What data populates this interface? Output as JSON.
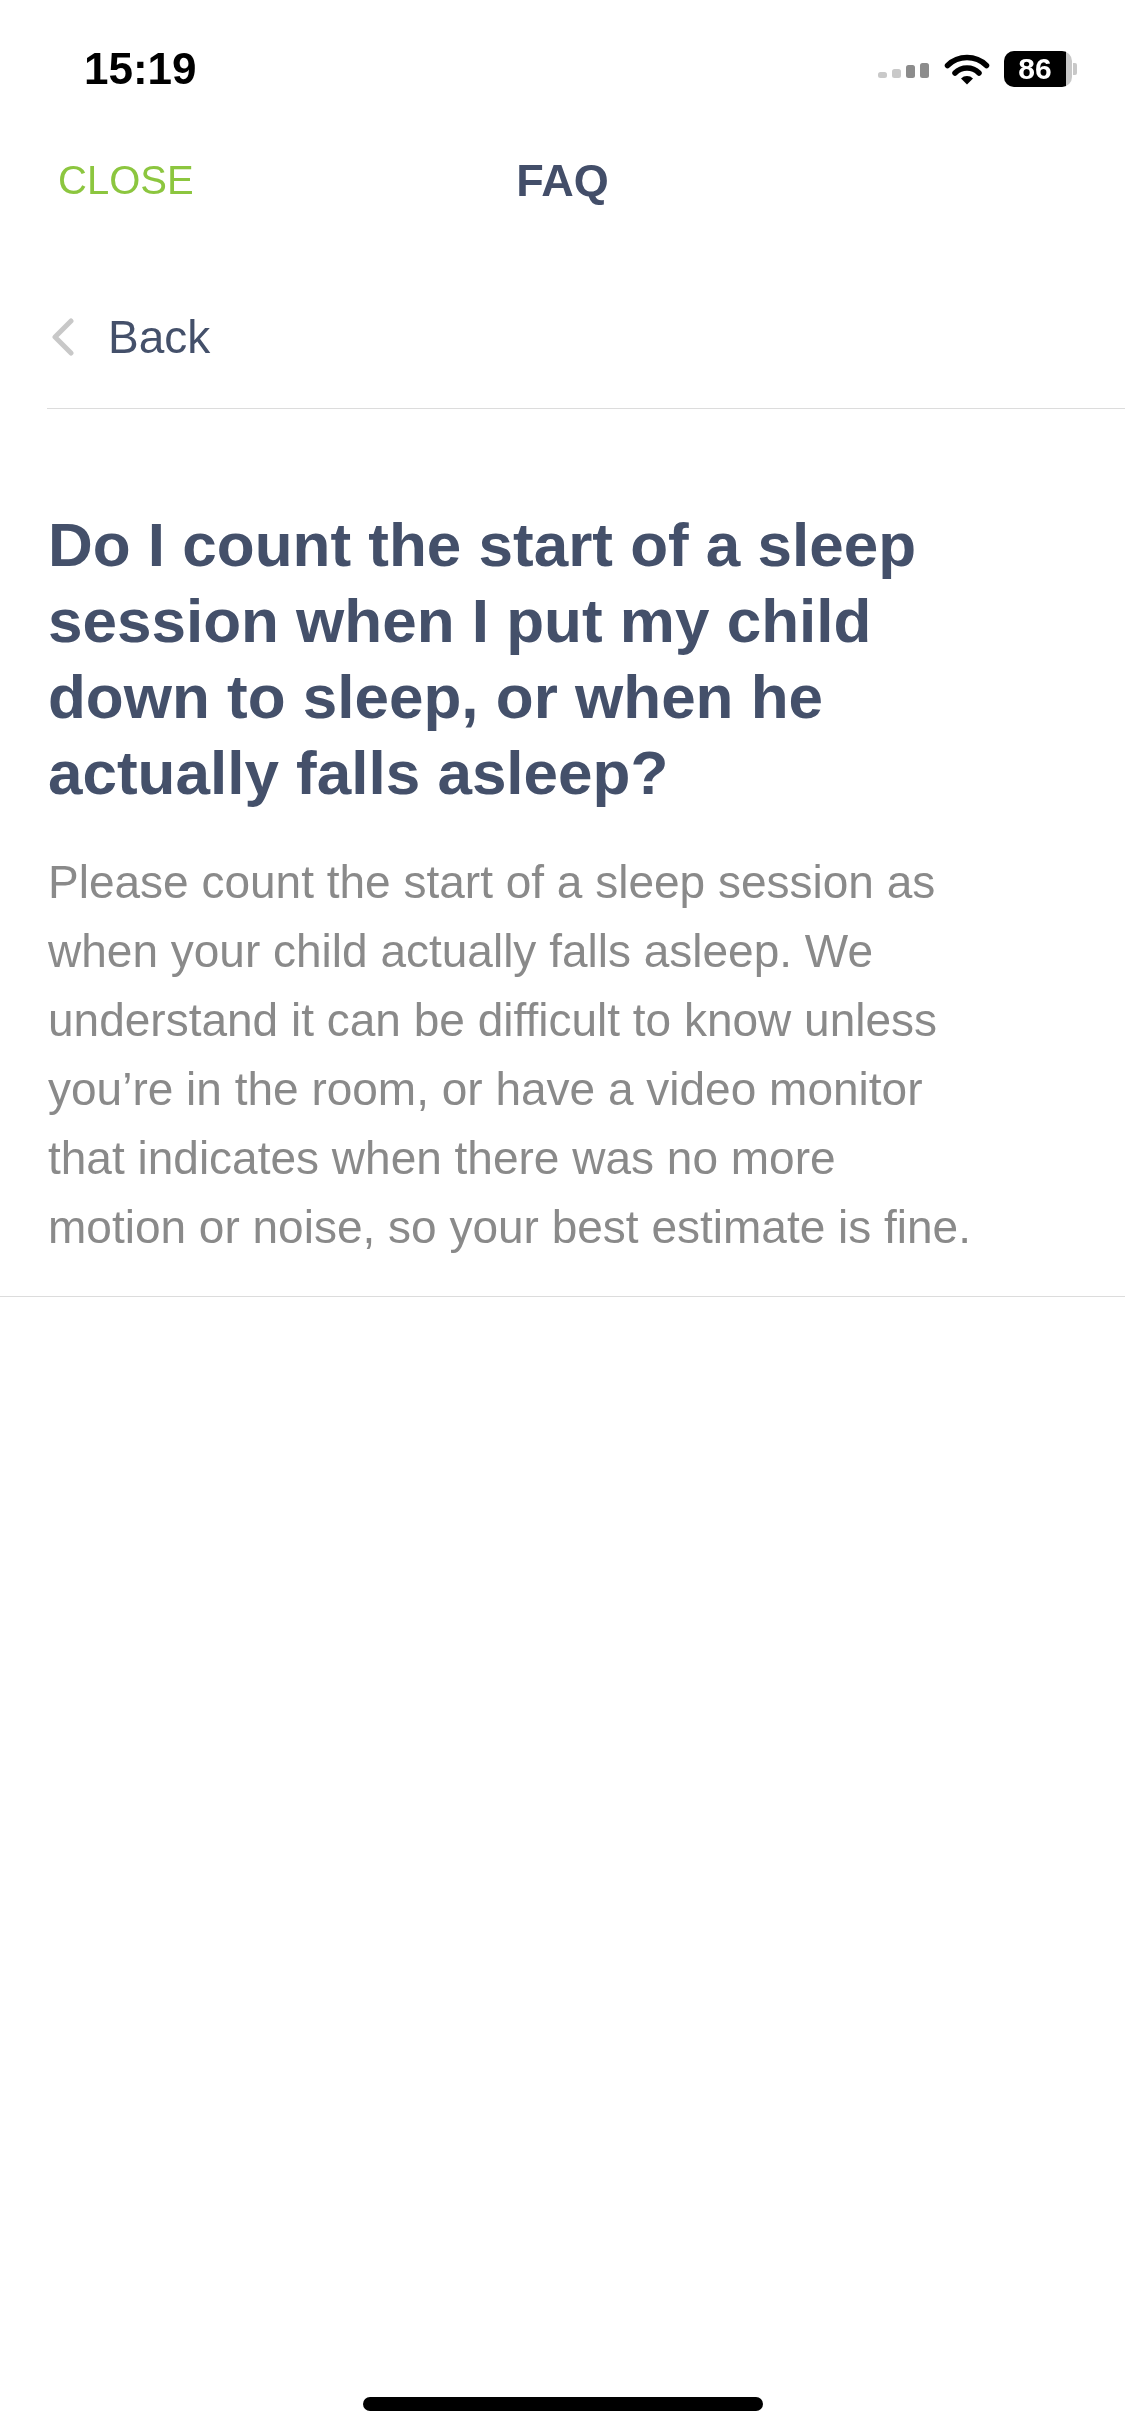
{
  "status_bar": {
    "time": "15:19",
    "battery": "86"
  },
  "nav": {
    "close": "CLOSE",
    "title": "FAQ"
  },
  "back": {
    "label": "Back"
  },
  "faq": {
    "question": "Do I count the start of a sleep session when I put my child down to sleep, or when he actually falls asleep?",
    "answer": "Please count the start of a sleep session as when your child actually falls asleep. We understand it can be difficult to know unless you’re in the room, or have a video monitor that indicates when there was no more motion or noise, so your best estimate is fine."
  }
}
